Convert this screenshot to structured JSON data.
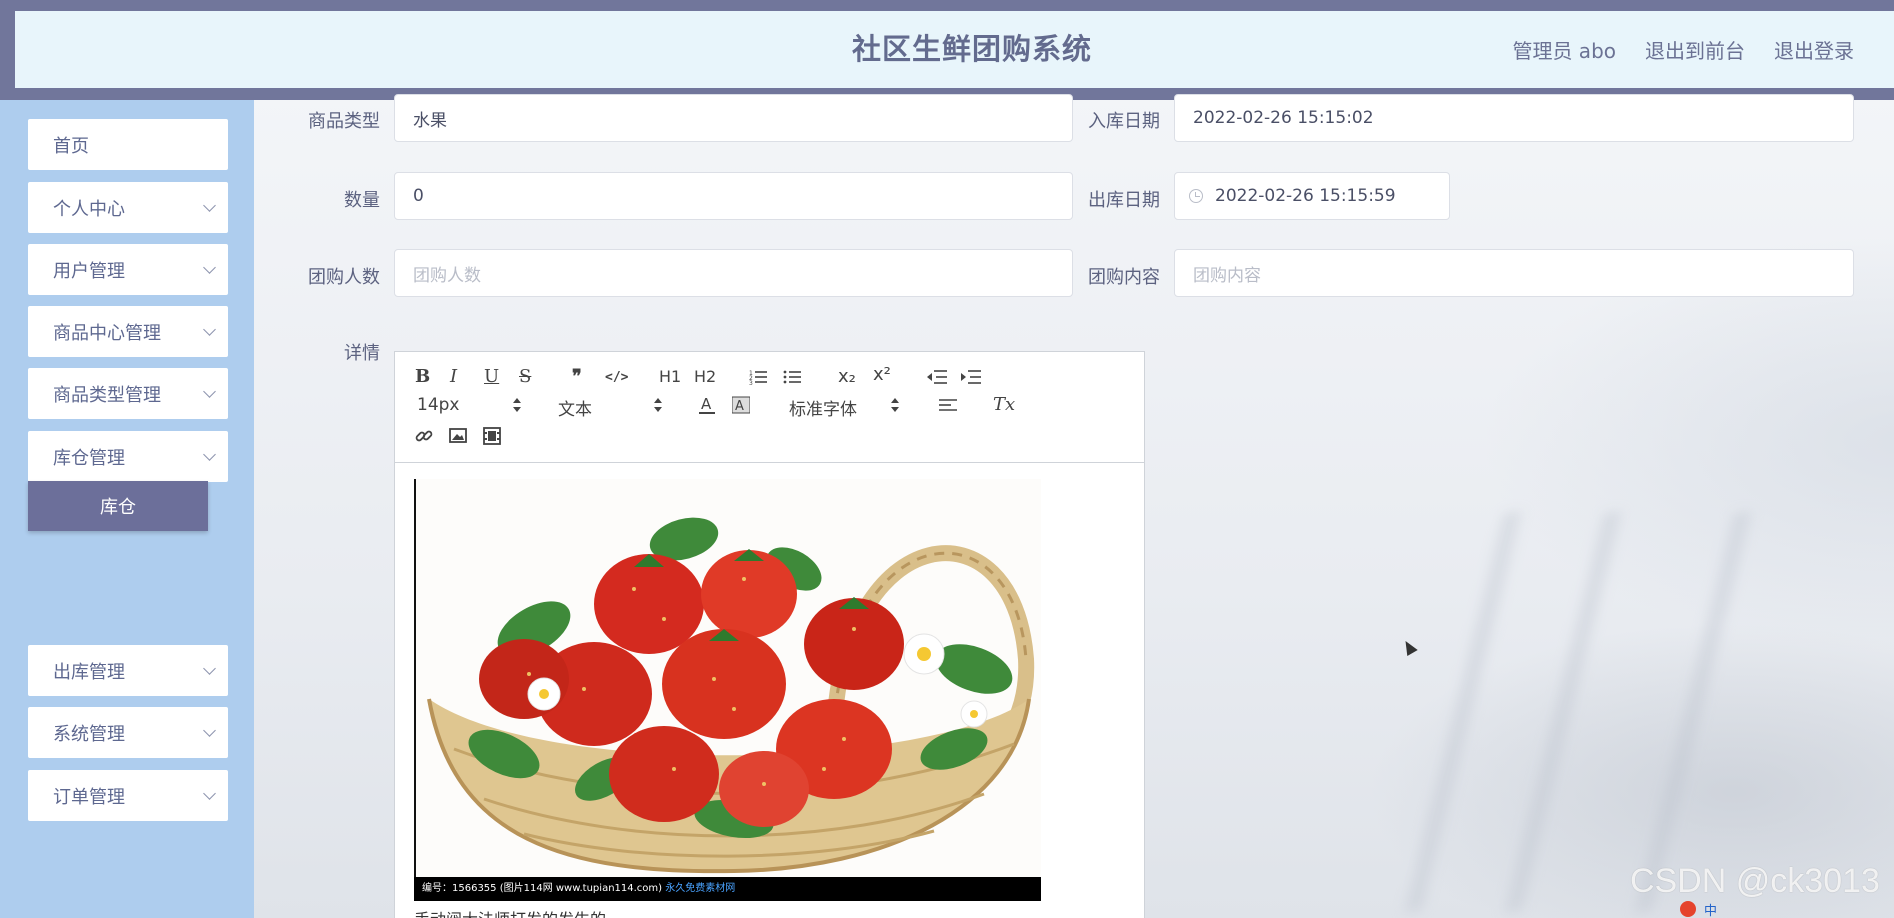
{
  "header": {
    "title": "社区生鲜团购系统",
    "user": "管理员 abo",
    "to_front": "退出到前台",
    "logout": "退出登录"
  },
  "sidebar": {
    "items": [
      {
        "label": "首页",
        "expandable": false
      },
      {
        "label": "个人中心",
        "expandable": true
      },
      {
        "label": "用户管理",
        "expandable": true
      },
      {
        "label": "商品中心管理",
        "expandable": true
      },
      {
        "label": "商品类型管理",
        "expandable": true
      },
      {
        "label": "库仓管理",
        "expandable": true
      },
      {
        "label": "出库管理",
        "expandable": true
      },
      {
        "label": "系统管理",
        "expandable": true
      },
      {
        "label": "订单管理",
        "expandable": true
      }
    ],
    "submenu": {
      "label": "库仓"
    }
  },
  "form": {
    "type_label": "商品类型",
    "type_value": "水果",
    "in_date_label": "入库日期",
    "in_date_value": "2022-02-26 15:15:02",
    "qty_label": "数量",
    "qty_value": "0",
    "out_date_label": "出库日期",
    "out_date_value": "2022-02-26 15:15:59",
    "group_count_label": "团购人数",
    "group_count_placeholder": "团购人数",
    "group_content_label": "团购内容",
    "group_content_placeholder": "团购内容",
    "details_label": "详情"
  },
  "editor": {
    "font_size": "14px",
    "block_type": "文本",
    "font_family": "标准字体",
    "buttons": {
      "bold": "B",
      "italic": "I",
      "underline": "U",
      "strike": "S",
      "quote": "❞",
      "code": "</>",
      "h1": "H1",
      "h2": "H2",
      "sub": "x₂",
      "sup": "x²",
      "clean": "Tx"
    },
    "image_caption": "编号：1566355 (图片114网 www.tupian114.com)",
    "image_caption_link": "永久免费素材网",
    "body_text": "手动阀大法师打发的发生的"
  },
  "watermark": "CSDN @ck3013",
  "tray": "中"
}
